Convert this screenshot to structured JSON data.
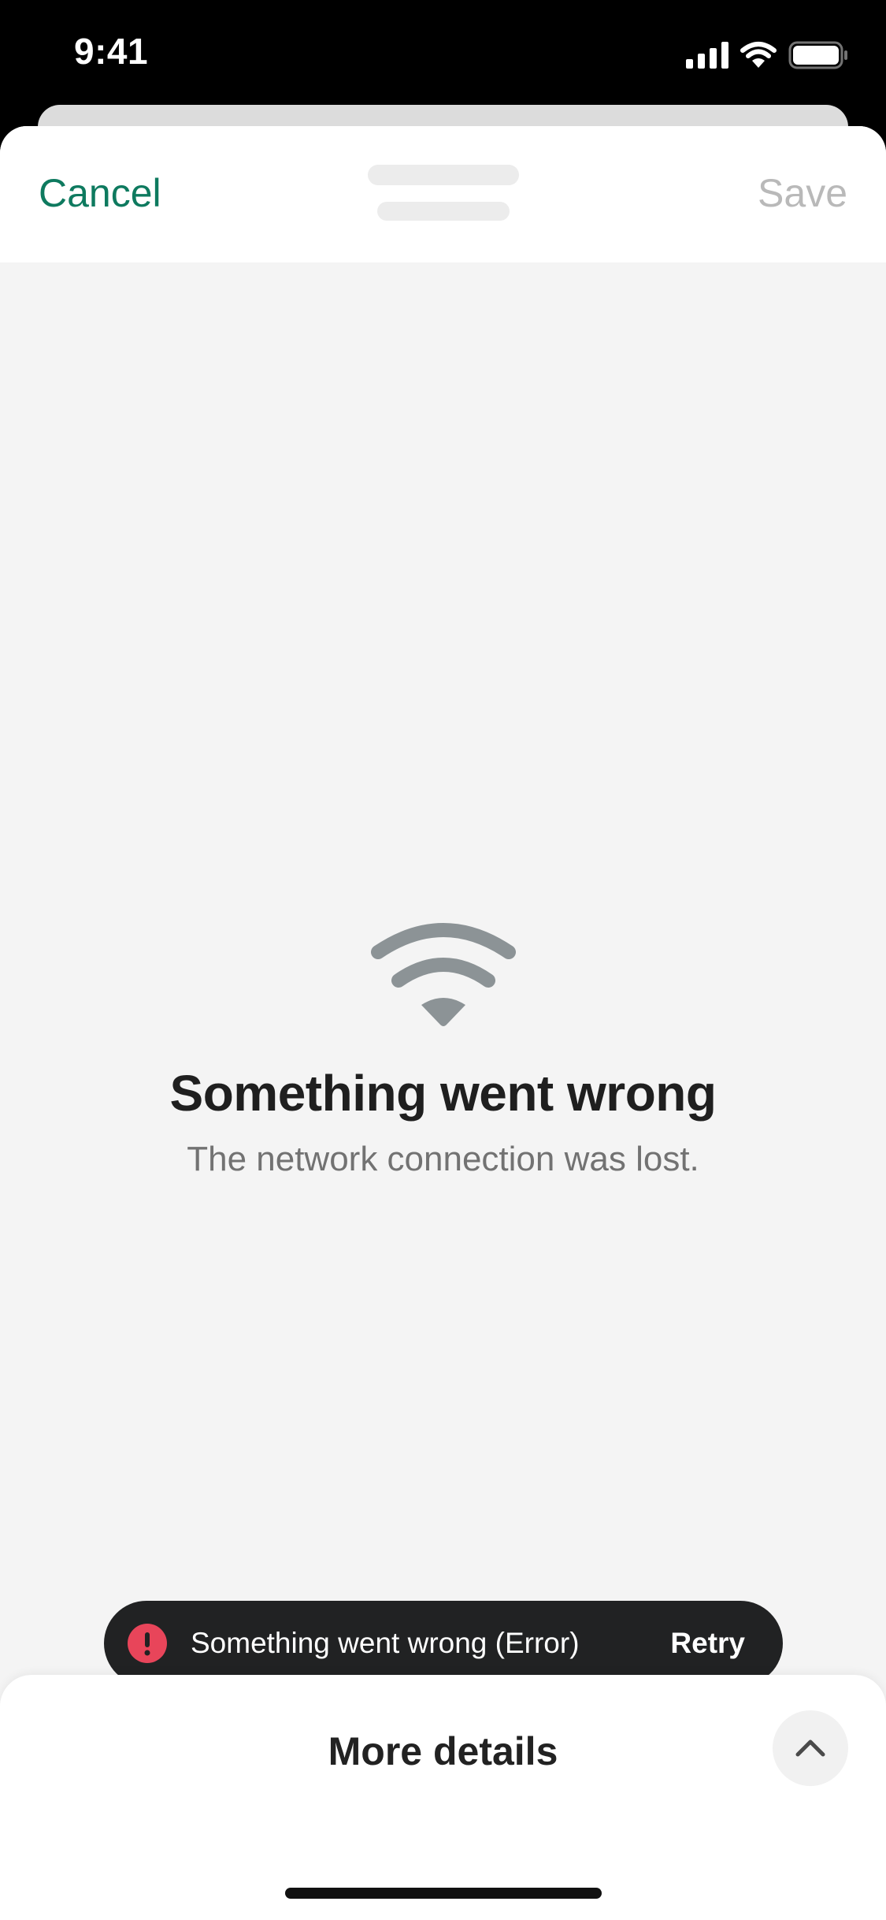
{
  "status_bar": {
    "time": "9:41",
    "icons": [
      "cellular-signal-icon",
      "wifi-icon",
      "battery-icon"
    ]
  },
  "nav": {
    "cancel_label": "Cancel",
    "save_label": "Save"
  },
  "error_state": {
    "icon": "wifi-icon",
    "title": "Something went wrong",
    "subtitle": "The network connection was lost."
  },
  "toast": {
    "icon": "alert-exclamation-icon",
    "message": "Something went wrong (Error)",
    "action_label": "Retry"
  },
  "drawer": {
    "title": "More details",
    "toggle_icon": "chevron-up-icon"
  },
  "colors": {
    "accent": "#0e7a5f",
    "disabled": "#b9b9b9",
    "error": "#e8455a",
    "toast_bg": "#212223",
    "page_bg": "#f4f4f4"
  }
}
